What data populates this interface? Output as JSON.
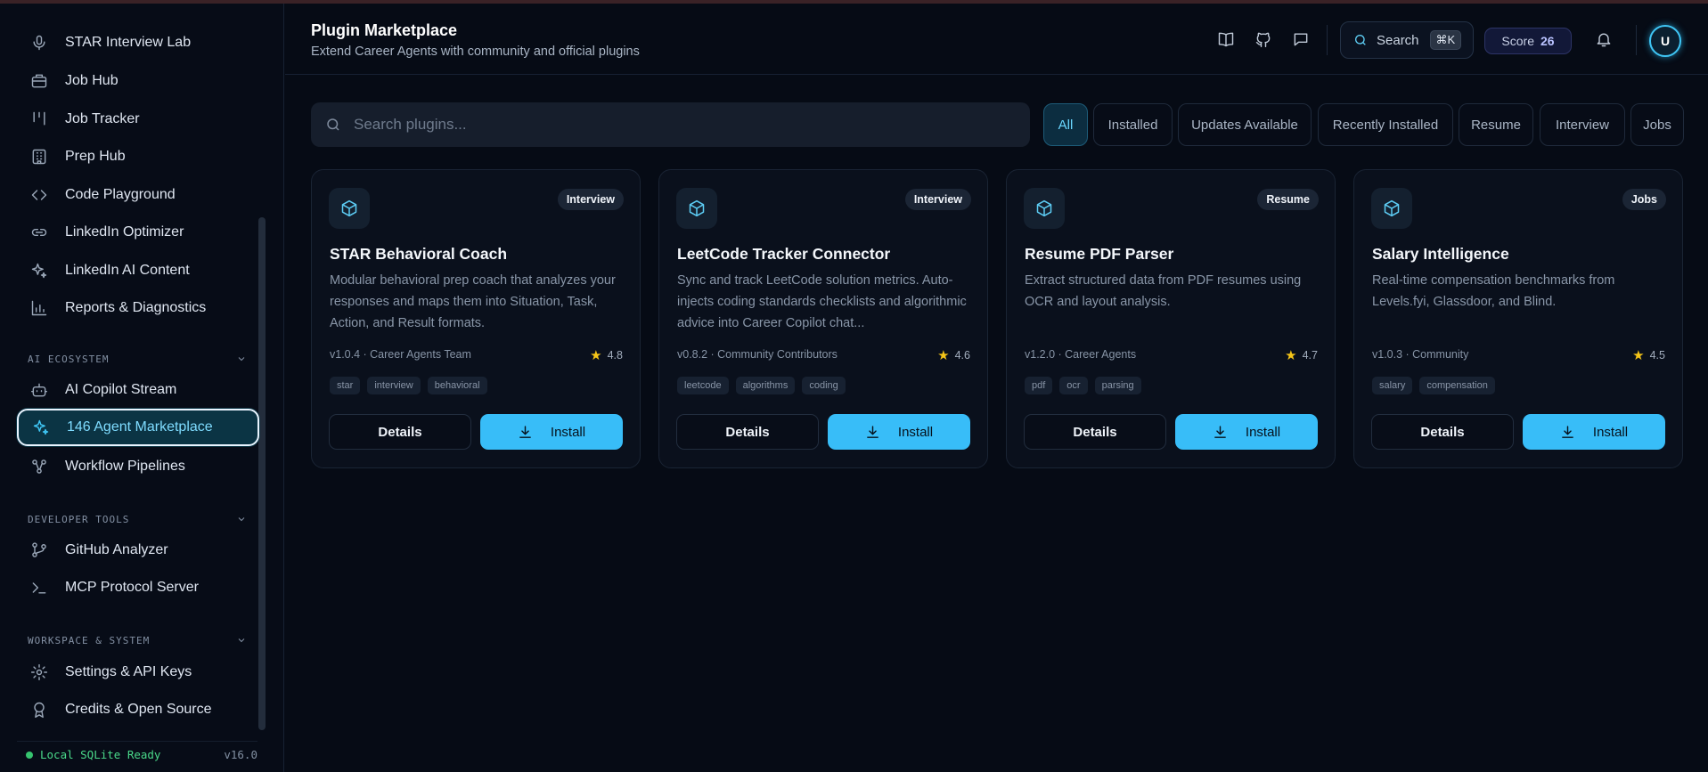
{
  "sidebar": {
    "items": [
      {
        "label": "STAR Interview Lab",
        "icon": "microphone-icon"
      },
      {
        "label": "Job Hub",
        "icon": "briefcase-icon"
      },
      {
        "label": "Job Tracker",
        "icon": "kanban-icon"
      },
      {
        "label": "Prep Hub",
        "icon": "building-icon"
      },
      {
        "label": "Code Playground",
        "icon": "code-icon"
      },
      {
        "label": "LinkedIn Optimizer",
        "icon": "link-icon"
      },
      {
        "label": "LinkedIn AI Content",
        "icon": "sparkles-icon"
      },
      {
        "label": "Reports & Diagnostics",
        "icon": "bar-chart-icon"
      },
      {
        "label": "AI Copilot Stream",
        "icon": "bot-icon"
      },
      {
        "label": "146 Agent Marketplace",
        "icon": "sparkles-icon"
      },
      {
        "label": "Workflow Pipelines",
        "icon": "workflow-icon"
      },
      {
        "label": "GitHub Analyzer",
        "icon": "git-branch-icon"
      },
      {
        "label": "MCP Protocol Server",
        "icon": "terminal-icon"
      },
      {
        "label": "Settings & API Keys",
        "icon": "gear-icon"
      },
      {
        "label": "Credits & Open Source",
        "icon": "award-icon"
      }
    ],
    "sections": {
      "ai_ecosystem": "AI ECOSYSTEM",
      "developer_tools": "DEVELOPER TOOLS",
      "workspace_system": "WORKSPACE & SYSTEM"
    },
    "footer": {
      "status": "Local SQLite Ready",
      "version": "v16.0"
    }
  },
  "header": {
    "title": "Plugin Marketplace",
    "subtitle": "Extend Career Agents with community and official plugins",
    "search_label": "Search",
    "search_shortcut": "⌘K",
    "score_label": "Score",
    "score_value": "26",
    "avatar_initial": "U"
  },
  "search": {
    "placeholder": "Search plugins..."
  },
  "filters": [
    "All",
    "Installed",
    "Updates Available",
    "Recently Installed",
    "Resume",
    "Interview",
    "Jobs"
  ],
  "cards": [
    {
      "category": "Interview",
      "name": "STAR Behavioral Coach",
      "description": "Modular behavioral prep coach that analyzes your responses and maps them into Situation, Task, Action, and Result formats.",
      "meta": "v1.0.4 · Career Agents Team",
      "rating": "4.8",
      "tags": [
        "star",
        "interview",
        "behavioral"
      ],
      "details_label": "Details",
      "install_label": "Install"
    },
    {
      "category": "Interview",
      "name": "LeetCode Tracker Connector",
      "description": "Sync and track LeetCode solution metrics. Auto-injects coding standards checklists and algorithmic advice into Career Copilot chat...",
      "meta": "v0.8.2 · Community Contributors",
      "rating": "4.6",
      "tags": [
        "leetcode",
        "algorithms",
        "coding"
      ],
      "details_label": "Details",
      "install_label": "Install"
    },
    {
      "category": "Resume",
      "name": "Resume PDF Parser",
      "description": "Extract structured data from PDF resumes using OCR and layout analysis.",
      "meta": "v1.2.0 · Career Agents",
      "rating": "4.7",
      "tags": [
        "pdf",
        "ocr",
        "parsing"
      ],
      "details_label": "Details",
      "install_label": "Install"
    },
    {
      "category": "Jobs",
      "name": "Salary Intelligence",
      "description": "Real-time compensation benchmarks from Levels.fyi, Glassdoor, and Blind.",
      "meta": "v1.0.3 · Community",
      "rating": "4.5",
      "tags": [
        "salary",
        "compensation"
      ],
      "details_label": "Details",
      "install_label": "Install"
    }
  ],
  "colors": {
    "accent": "#38bdf8",
    "background": "#060b15",
    "status_ok": "#4ad98a"
  }
}
